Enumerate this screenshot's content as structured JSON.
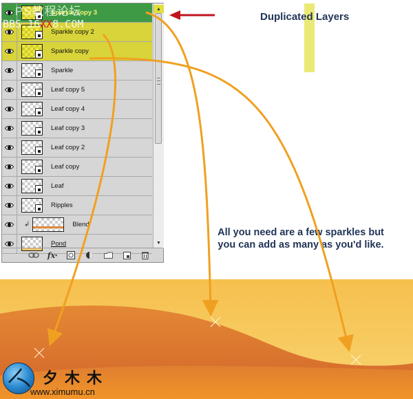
{
  "layers_panel": {
    "layers": [
      {
        "name": "Sparkle copy 3",
        "state": "selected-active",
        "visible": true,
        "thumbnail": "smart-object"
      },
      {
        "name": "Sparkle copy 2",
        "state": "selected",
        "visible": true,
        "thumbnail": "smart-object"
      },
      {
        "name": "Sparkle copy",
        "state": "selected",
        "visible": true,
        "thumbnail": "smart-object"
      },
      {
        "name": "Sparkle",
        "state": "normal",
        "visible": true,
        "thumbnail": "smart-object"
      },
      {
        "name": "Leaf copy 5",
        "state": "normal",
        "visible": true,
        "thumbnail": "smart-object"
      },
      {
        "name": "Leaf copy 4",
        "state": "normal",
        "visible": true,
        "thumbnail": "smart-object"
      },
      {
        "name": "Leaf copy 3",
        "state": "normal",
        "visible": true,
        "thumbnail": "smart-object"
      },
      {
        "name": "Leaf copy 2",
        "state": "normal",
        "visible": true,
        "thumbnail": "smart-object"
      },
      {
        "name": "Leaf copy",
        "state": "normal",
        "visible": true,
        "thumbnail": "smart-object"
      },
      {
        "name": "Leaf",
        "state": "normal",
        "visible": true,
        "thumbnail": "smart-object"
      },
      {
        "name": "Ripples",
        "state": "normal",
        "visible": true,
        "thumbnail": "smart-object"
      },
      {
        "name": "Blend",
        "state": "normal",
        "visible": true,
        "thumbnail": "clipped-layer"
      },
      {
        "name": "Pond",
        "state": "normal",
        "visible": true,
        "thumbnail": "layer"
      }
    ],
    "footer_icons": [
      "link-layers-icon",
      "fx-icon",
      "add-mask-icon",
      "adjustment-layer-icon",
      "new-group-icon",
      "new-layer-icon",
      "trash-icon"
    ],
    "fx_label": "fx",
    "clip_glyph": "↲"
  },
  "annotations": {
    "title": "Duplicated Layers",
    "note": "All you need are a few sparkles but you can add as many as you'd like."
  },
  "watermark": {
    "line1": "PS教程论坛",
    "line2_a": "BBS.16",
    "line2_b": "XX",
    "line2_c": "8.COM"
  },
  "logo": {
    "chinese": "夕木木",
    "url": "www.ximumu.cn"
  },
  "colors": {
    "selected_active": "#3e9a45",
    "selected": "#d8d43a",
    "arrow_orange": "#f0a020",
    "arrow_red": "#c0141c",
    "text_navy": "#1f3356"
  }
}
